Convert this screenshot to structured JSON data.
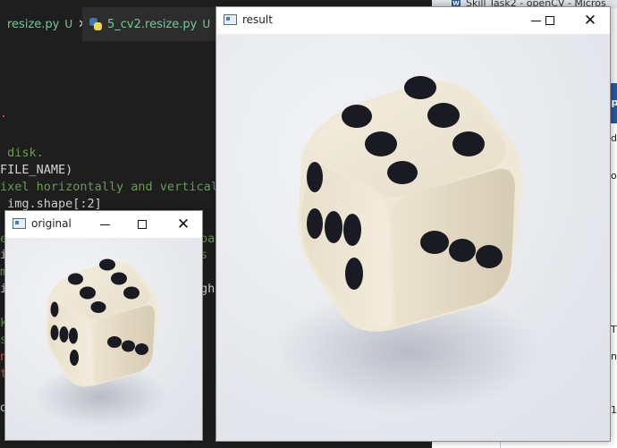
{
  "editor": {
    "tabs": [
      {
        "label": "resize.py",
        "status": "U",
        "close": "✕"
      },
      {
        "label": "5_cv2.resize.py",
        "status": "U",
        "close": "✕"
      }
    ],
    "code_lines": [
      {
        "text": ".",
        "color": "#f44747"
      },
      {
        "text": " disk.",
        "color": "#6a9955"
      },
      {
        "text": "FILE_NAME)",
        "color": "#d4d4d4"
      },
      {
        "text": "ixel horizontally and vertically",
        "color": "#6a9955"
      },
      {
        "text": " img.shape[:2]",
        "color": "#d4d4d4"
      },
      {
        "text": "e",
        "color": "#6a9955"
      },
      {
        "text": "i",
        "color": "#d4d4d4"
      },
      {
        "text": "m",
        "color": "#6a9955"
      },
      {
        "text": "i",
        "color": "#d4d4d4"
      },
      {
        "text": "k",
        "color": "#6a9955"
      },
      {
        "text": "s",
        "color": "#6a9955"
      },
      {
        "text": "n",
        "color": "#f44747"
      },
      {
        "text": "t",
        "color": "#f44747"
      },
      {
        "text": "d",
        "color": "#d4d4d4"
      }
    ],
    "peek_fragments": [
      "pat",
      "s c",
      "ght"
    ]
  },
  "background_app": {
    "title": "Skill Task2 - openCV - Micros",
    "edge_letters": [
      "op",
      "d",
      "o",
      "T",
      "n",
      "1"
    ]
  },
  "window_result": {
    "title": "result",
    "minimize": "minimize",
    "maximize": "maximize",
    "close": "close"
  },
  "window_original": {
    "title": "original",
    "minimize": "minimize",
    "maximize": "maximize",
    "close": "close"
  },
  "colors": {
    "editor_bg": "#1e1e1e",
    "tab_untracked": "#73c991",
    "comment": "#6a9955",
    "window_bg": "#ffffff",
    "die_body": "#efe8d6",
    "pip": "#1a1a22"
  },
  "icons": [
    "python-file-icon",
    "close-icon",
    "app-window-icon",
    "minimize-icon",
    "maximize-icon",
    "close-icon"
  ]
}
